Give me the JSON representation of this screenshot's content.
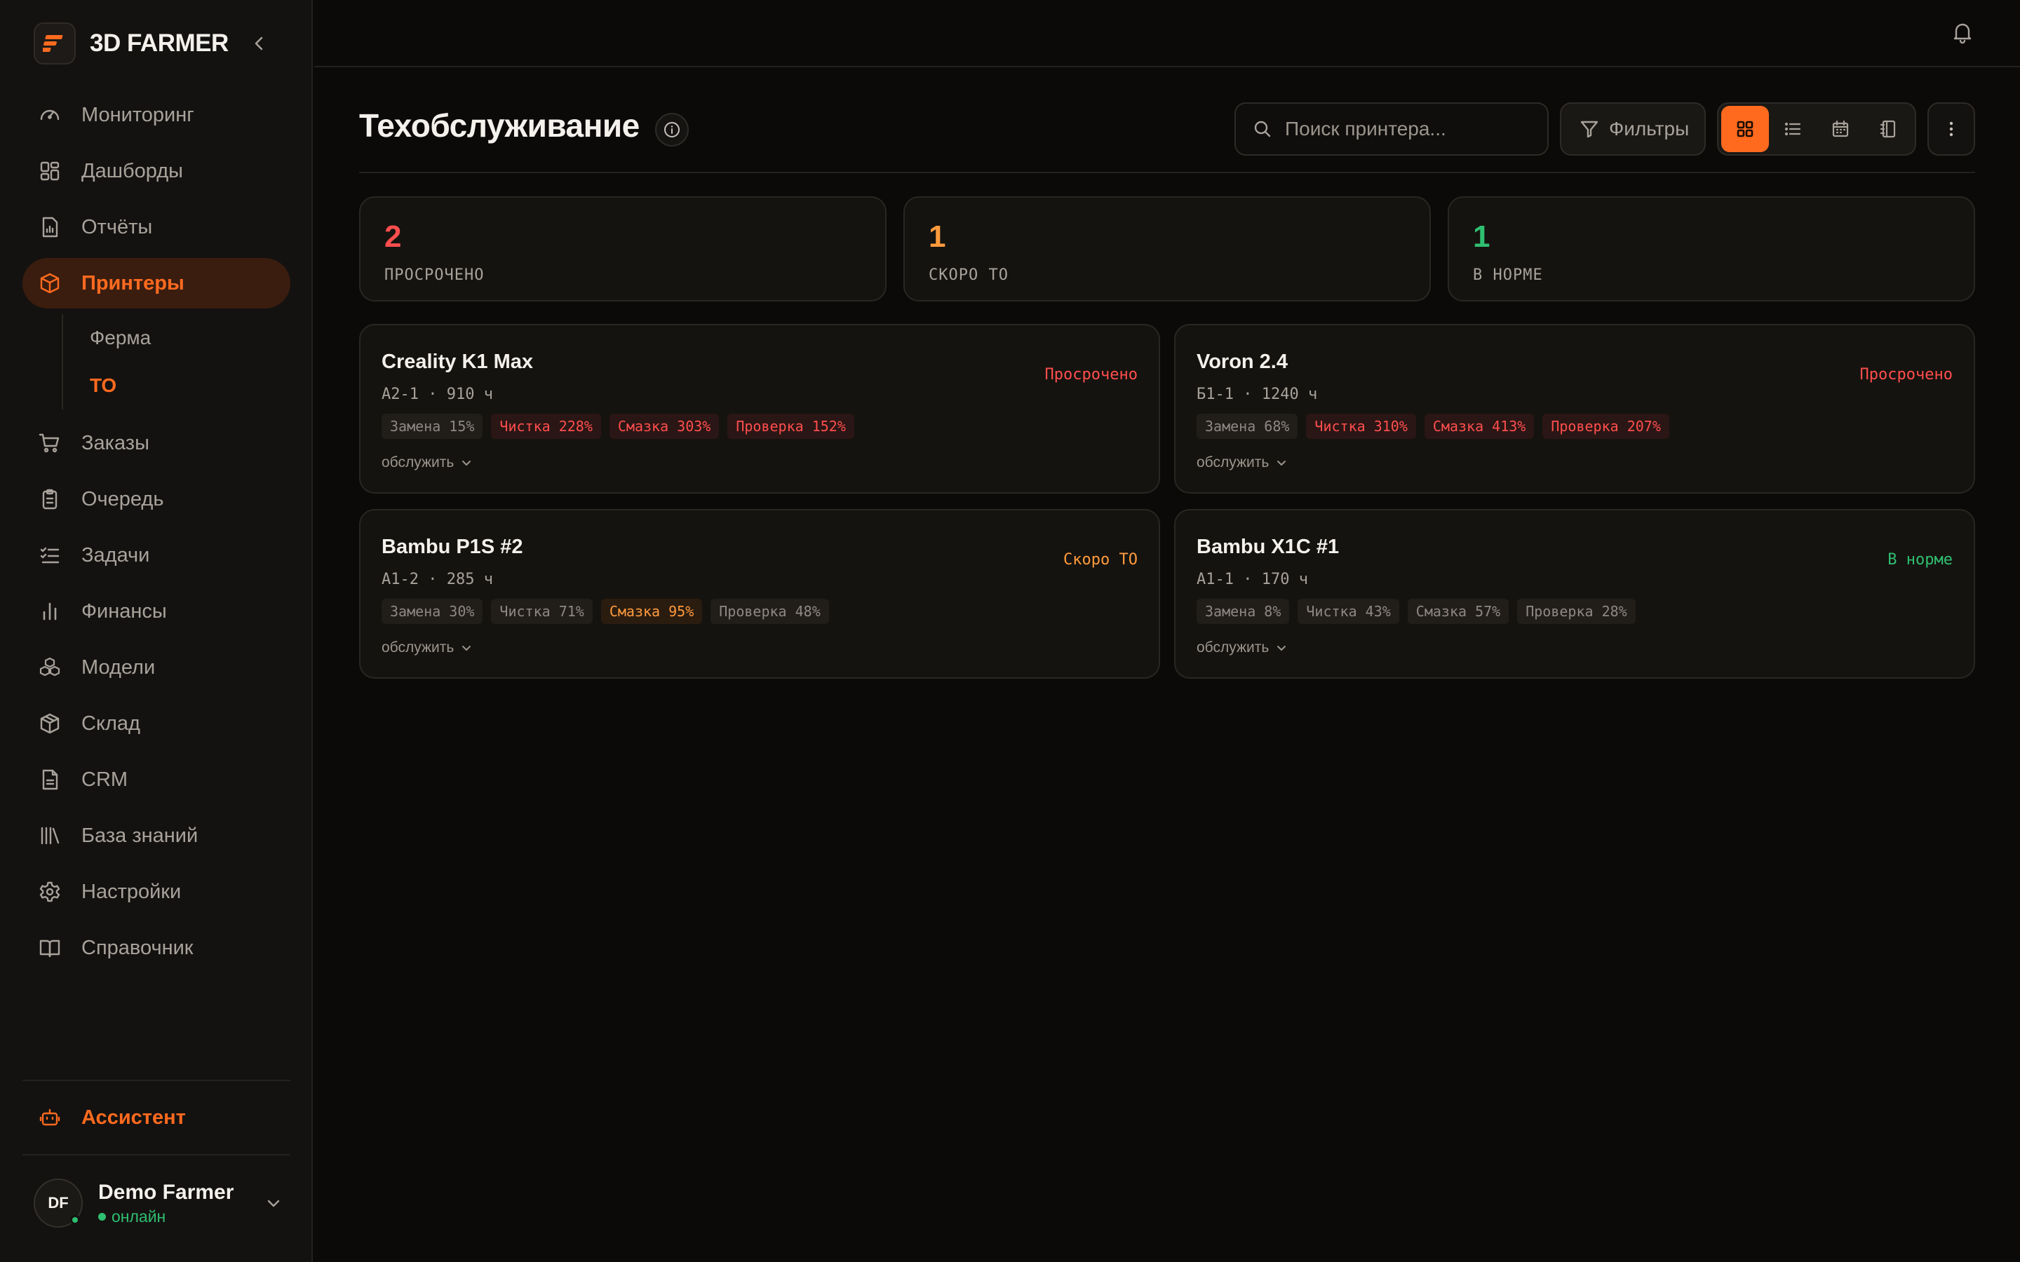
{
  "app": {
    "name": "3D FARMER"
  },
  "sidebar": {
    "items": [
      {
        "label": "Мониторинг",
        "icon": "gauge-icon"
      },
      {
        "label": "Дашборды",
        "icon": "dashboard-grid-icon"
      },
      {
        "label": "Отчёты",
        "icon": "report-icon"
      },
      {
        "label": "Принтеры",
        "icon": "box-icon",
        "active": true
      },
      {
        "label": "Заказы",
        "icon": "cart-icon"
      },
      {
        "label": "Очередь",
        "icon": "clipboard-icon"
      },
      {
        "label": "Задачи",
        "icon": "checklist-icon"
      },
      {
        "label": "Финансы",
        "icon": "bar-chart-icon"
      },
      {
        "label": "Модели",
        "icon": "cubes-icon"
      },
      {
        "label": "Склад",
        "icon": "package-icon"
      },
      {
        "label": "CRM",
        "icon": "document-icon"
      },
      {
        "label": "База знаний",
        "icon": "library-icon"
      },
      {
        "label": "Настройки",
        "icon": "gear-icon"
      },
      {
        "label": "Справочник",
        "icon": "book-icon"
      }
    ],
    "subitems": [
      {
        "label": "Ферма"
      },
      {
        "label": "ТО",
        "active": true
      }
    ],
    "assistant_label": "Ассистент",
    "user": {
      "initials": "DF",
      "name": "Demo Farmer",
      "status": "онлайн"
    }
  },
  "header": {
    "title": "Техобслуживание",
    "search_placeholder": "Поиск принтера...",
    "filters_label": "Фильтры"
  },
  "stats": [
    {
      "value": "2",
      "label": "ПРОСРОЧЕНО",
      "color": "#ff4e4e"
    },
    {
      "value": "1",
      "label": "СКОРО ТО",
      "color": "#ff9b3d"
    },
    {
      "value": "1",
      "label": "В НОРМЕ",
      "color": "#2fbf71"
    }
  ],
  "printers": [
    {
      "name": "Creality K1 Max",
      "meta": "A2-1 · 910 ч",
      "status": "Просрочено",
      "status_color": "red",
      "tags": [
        {
          "label": "Замена 15%",
          "level": "normal"
        },
        {
          "label": "Чистка 228%",
          "level": "red"
        },
        {
          "label": "Смазка 303%",
          "level": "red"
        },
        {
          "label": "Проверка 152%",
          "level": "red"
        }
      ],
      "action": "обслужить"
    },
    {
      "name": "Voron 2.4",
      "meta": "Б1-1 · 1240 ч",
      "status": "Просрочено",
      "status_color": "red",
      "tags": [
        {
          "label": "Замена 68%",
          "level": "normal"
        },
        {
          "label": "Чистка 310%",
          "level": "red"
        },
        {
          "label": "Смазка 413%",
          "level": "red"
        },
        {
          "label": "Проверка 207%",
          "level": "red"
        }
      ],
      "action": "обслужить"
    },
    {
      "name": "Bambu P1S #2",
      "meta": "A1-2 · 285 ч",
      "status": "Скоро ТО",
      "status_color": "orange",
      "tags": [
        {
          "label": "Замена 30%",
          "level": "normal"
        },
        {
          "label": "Чистка 71%",
          "level": "normal"
        },
        {
          "label": "Смазка 95%",
          "level": "orange"
        },
        {
          "label": "Проверка 48%",
          "level": "normal"
        }
      ],
      "action": "обслужить"
    },
    {
      "name": "Bambu X1C #1",
      "meta": "A1-1 · 170 ч",
      "status": "В норме",
      "status_color": "green",
      "tags": [
        {
          "label": "Замена 8%",
          "level": "normal"
        },
        {
          "label": "Чистка 43%",
          "level": "normal"
        },
        {
          "label": "Смазка 57%",
          "level": "normal"
        },
        {
          "label": "Проверка 28%",
          "level": "normal"
        }
      ],
      "action": "обслужить"
    }
  ],
  "colors": {
    "accent": "#ff6a1f",
    "danger": "#ff4e4e",
    "warning": "#ff9b3d",
    "ok": "#2fbf71"
  }
}
